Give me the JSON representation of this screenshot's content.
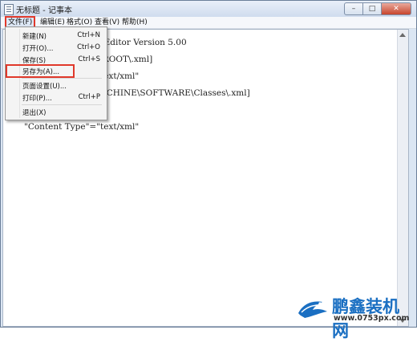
{
  "window": {
    "title": "无标题 - 记事本"
  },
  "menubar": [
    "文件(F)",
    "编辑(E)",
    "格式(O)",
    "查看(V)",
    "帮助(H)"
  ],
  "file_menu": {
    "new": {
      "label": "新建(N)",
      "shortcut": "Ctrl+N"
    },
    "open": {
      "label": "打开(O)...",
      "shortcut": "Ctrl+O"
    },
    "save": {
      "label": "保存(S)",
      "shortcut": "Ctrl+S"
    },
    "save_as": {
      "label": "另存为(A)..."
    },
    "page_setup": {
      "label": "页面设置(U)..."
    },
    "print": {
      "label": "打印(P)...",
      "shortcut": "Ctrl+P"
    },
    "exit": {
      "label": "退出(X)"
    }
  },
  "editor": {
    "text": "Windows Registry Editor Version 5.00\n[HKEY_CLASSES_ROOT\\.xml]\n\"Content Type\"=\"text/xml\"\n[HKEY_LOCAL_MACHINE\\SOFTWARE\\Classes\\.xml]\n@=\"xmlfile\"\n\"Content Type\"=\"text/xml\""
  },
  "watermark": {
    "brand": "鹏鑫装机网",
    "url": "www.0753px.com"
  }
}
